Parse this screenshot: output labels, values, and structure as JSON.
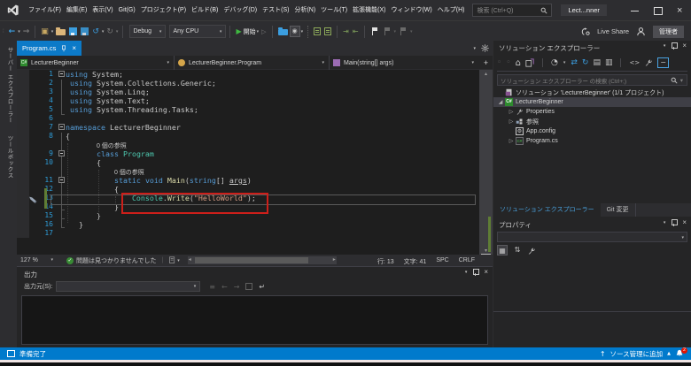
{
  "titlebar": {
    "menus": [
      "ファイル(F)",
      "編集(E)",
      "表示(V)",
      "Git(G)",
      "プロジェクト(P)",
      "ビルド(B)",
      "デバッグ(D)",
      "テスト(S)",
      "分析(N)",
      "ツール(T)",
      "拡張機能(X)",
      "ウィンドウ(W)",
      "ヘルプ(H)"
    ],
    "search_placeholder": "検索 (Ctrl+Q)",
    "window_title": "Lect...nner"
  },
  "toolbar": {
    "config": "Debug",
    "platform": "Any CPU",
    "start_label": "開始",
    "live_share": "Live Share",
    "admin": "管理者"
  },
  "left_strip": {
    "tabs": [
      "サーバー エクスプローラー",
      "ツールボックス"
    ]
  },
  "editor": {
    "tab_title": "Program.cs",
    "breadcrumbs": [
      "LecturerBeginner",
      "LecturerBeginner.Program",
      "Main(string[] args)"
    ],
    "codelens_label": "0 個の参照",
    "zoom": "127 %",
    "health": "問題は見つかりませんでした",
    "line_indicator": "行: 13",
    "col_indicator": "文字: 41",
    "spaces_indicator": "SPC",
    "eol_indicator": "CRLF",
    "lines": [
      {
        "n": "1",
        "fold": true,
        "tokens": [
          [
            "k",
            "using"
          ],
          [
            "p",
            " System;"
          ]
        ]
      },
      {
        "n": "2",
        "tokens": [
          [
            "p",
            " "
          ],
          [
            "k",
            "using"
          ],
          [
            "p",
            " System.Collections.Generic;"
          ]
        ]
      },
      {
        "n": "3",
        "tokens": [
          [
            "p",
            " "
          ],
          [
            "k",
            "using"
          ],
          [
            "p",
            " System.Linq;"
          ]
        ]
      },
      {
        "n": "4",
        "tokens": [
          [
            "p",
            " "
          ],
          [
            "k",
            "using"
          ],
          [
            "p",
            " System.Text;"
          ]
        ]
      },
      {
        "n": "5",
        "tokens": [
          [
            "p",
            " "
          ],
          [
            "k",
            "using"
          ],
          [
            "p",
            " System.Threading.Tasks;"
          ]
        ]
      },
      {
        "n": "6",
        "tokens": []
      },
      {
        "n": "7",
        "fold": true,
        "tokens": [
          [
            "k",
            "namespace"
          ],
          [
            "p",
            " LecturerBeginner"
          ]
        ]
      },
      {
        "n": "8",
        "tokens": [
          [
            "p",
            "{"
          ]
        ]
      },
      {
        "lens": true,
        "pad": "       "
      },
      {
        "n": "9",
        "fold": true,
        "tokens": [
          [
            "p",
            "       "
          ],
          [
            "k",
            "class"
          ],
          [
            "p",
            " "
          ],
          [
            "t",
            "Program"
          ]
        ]
      },
      {
        "n": "10",
        "tokens": [
          [
            "p",
            "       {"
          ]
        ]
      },
      {
        "lens": true,
        "pad": "           "
      },
      {
        "n": "11",
        "fold": true,
        "tokens": [
          [
            "p",
            "           "
          ],
          [
            "k",
            "static"
          ],
          [
            "p",
            " "
          ],
          [
            "k",
            "void"
          ],
          [
            "p",
            " "
          ],
          [
            "m",
            "Main"
          ],
          [
            "p",
            "("
          ],
          [
            "k",
            "string"
          ],
          [
            "p",
            "[] "
          ],
          [
            "u",
            "args"
          ],
          [
            "p",
            ")"
          ]
        ]
      },
      {
        "n": "12",
        "tokens": [
          [
            "p",
            "           {"
          ]
        ]
      },
      {
        "n": "13",
        "tokens": [
          [
            "p",
            "               "
          ],
          [
            "t",
            "Console"
          ],
          [
            "p",
            "."
          ],
          [
            "m",
            "Write"
          ],
          [
            "p",
            "("
          ],
          [
            "s",
            "\"HelloWorld\""
          ],
          [
            "p",
            ");"
          ]
        ]
      },
      {
        "n": "14",
        "tokens": [
          [
            "p",
            "           }"
          ]
        ]
      },
      {
        "n": "15",
        "tokens": [
          [
            "p",
            "       }"
          ]
        ]
      },
      {
        "n": "16",
        "tokens": [
          [
            "p",
            "   }"
          ]
        ]
      },
      {
        "n": "17",
        "tokens": []
      }
    ]
  },
  "output": {
    "title": "出力",
    "source_label": "出力元(S):"
  },
  "solution_explorer": {
    "title": "ソリューション エクスプローラー",
    "search_placeholder": "ソリューション エクスプローラー の検索 (Ctrl+;)",
    "items": [
      {
        "icon": "solution",
        "label": "ソリューション 'LecturerBeginner' (1/1 プロジェクト)",
        "indent": 0,
        "expander": ""
      },
      {
        "icon": "csproj",
        "label": "LecturerBeginner",
        "indent": 0,
        "expander": "open",
        "selected": true
      },
      {
        "icon": "properties",
        "label": "Properties",
        "indent": 1,
        "expander": "closed"
      },
      {
        "icon": "references",
        "label": "参照",
        "indent": 1,
        "expander": "closed"
      },
      {
        "icon": "config",
        "label": "App.config",
        "indent": 1,
        "expander": ""
      },
      {
        "icon": "csfile",
        "label": "Program.cs",
        "indent": 1,
        "expander": "closed"
      }
    ],
    "tabs": [
      {
        "label": "ソリューション エクスプローラー",
        "active": true
      },
      {
        "label": "Git 変更",
        "active": false
      }
    ]
  },
  "properties": {
    "title": "プロパティ"
  },
  "statusbar": {
    "ready": "準備完了",
    "add_source_control": "ソース管理に追加",
    "notification_count": "2"
  },
  "icon_glyphs": {
    "csharp": "C#"
  }
}
